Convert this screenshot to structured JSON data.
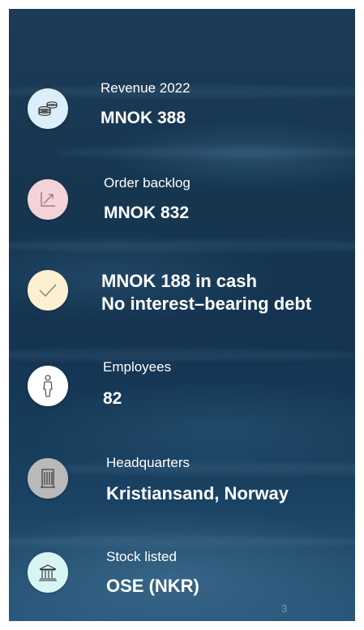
{
  "items": [
    {
      "label": "Revenue 2022",
      "value": "MNOK 388",
      "icon": "coins-icon",
      "color": "#dbeef9"
    },
    {
      "label": "Order backlog",
      "value": "MNOK 832",
      "icon": "trend-up-icon",
      "color": "#f3d3d8"
    },
    {
      "label": "",
      "value_line1": "MNOK 188 in cash",
      "value_line2": "No interest–bearing debt",
      "icon": "checkmark-icon",
      "color": "#fbf0cf"
    },
    {
      "label": "Employees",
      "value": "82",
      "icon": "person-icon",
      "color": "#ffffff"
    },
    {
      "label": "Headquarters",
      "value": "Kristiansand, Norway",
      "icon": "building-icon",
      "color": "#b9b9b9"
    },
    {
      "label": "Stock listed",
      "value": "OSE (NKR)",
      "icon": "bank-icon",
      "color": "#d8f4f5"
    }
  ],
  "page_number": "3"
}
